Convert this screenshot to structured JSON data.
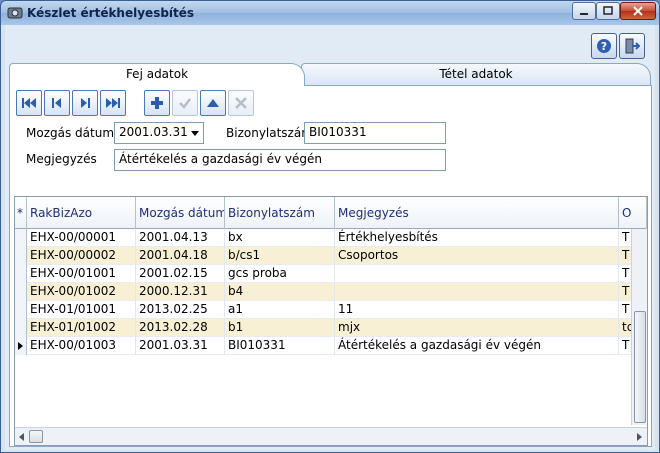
{
  "window": {
    "title": "Készlet értékhelyesbítés"
  },
  "tabs": [
    {
      "label": "Fej adatok",
      "active": true
    },
    {
      "label": "Tétel adatok",
      "active": false
    }
  ],
  "toolbar": {
    "buttons": [
      {
        "icon": "first-record-icon"
      },
      {
        "icon": "previous-record-icon"
      },
      {
        "icon": "next-record-icon"
      },
      {
        "icon": "last-record-icon"
      },
      {
        "icon": "add-icon"
      },
      {
        "icon": "confirm-icon",
        "enabled": false
      },
      {
        "icon": "up-icon"
      },
      {
        "icon": "delete-icon",
        "enabled": false
      }
    ]
  },
  "form": {
    "date_label": "Mozgás dátuma",
    "date_value": "2001.03.31",
    "doc_label": "Bizonylatszám",
    "doc_value": "BI010331",
    "note_label": "Megjegyzés",
    "note_value": "Átértékelés a gazdasági év végén"
  },
  "grid": {
    "indicator_header": "*",
    "columns": [
      "RakBizAzo",
      "Mozgás dátuma",
      "Bizonylatszám",
      "Megjegyzés",
      "O"
    ],
    "rows": [
      {
        "cells": [
          "EHX-00/00001",
          "2001.04.13",
          "bx",
          "Értékhelyesbítés",
          "T"
        ],
        "current": false
      },
      {
        "cells": [
          "EHX-00/00002",
          "2001.04.18",
          "b/cs1",
          "Csoportos",
          "T"
        ],
        "current": false
      },
      {
        "cells": [
          "EHX-00/01001",
          "2001.02.15",
          "gcs proba",
          "",
          "T"
        ],
        "current": false
      },
      {
        "cells": [
          "EHX-00/01002",
          "2000.12.31",
          "b4",
          "",
          "T"
        ],
        "current": false
      },
      {
        "cells": [
          "EHX-01/01001",
          "2013.02.25",
          "a1",
          "11",
          "T"
        ],
        "current": false
      },
      {
        "cells": [
          "EHX-01/01002",
          "2013.02.28",
          "b1",
          "mjx",
          "tc"
        ],
        "current": false
      },
      {
        "cells": [
          "EHX-00/01003",
          "2001.03.31",
          "BI010331",
          "Átértékelés a gazdasági év végén",
          "T"
        ],
        "current": true
      }
    ]
  },
  "colors": {
    "alt_row": "#f7f0d4",
    "header_text": "#1f2f7a",
    "nav_blue": "#2a5db0"
  }
}
